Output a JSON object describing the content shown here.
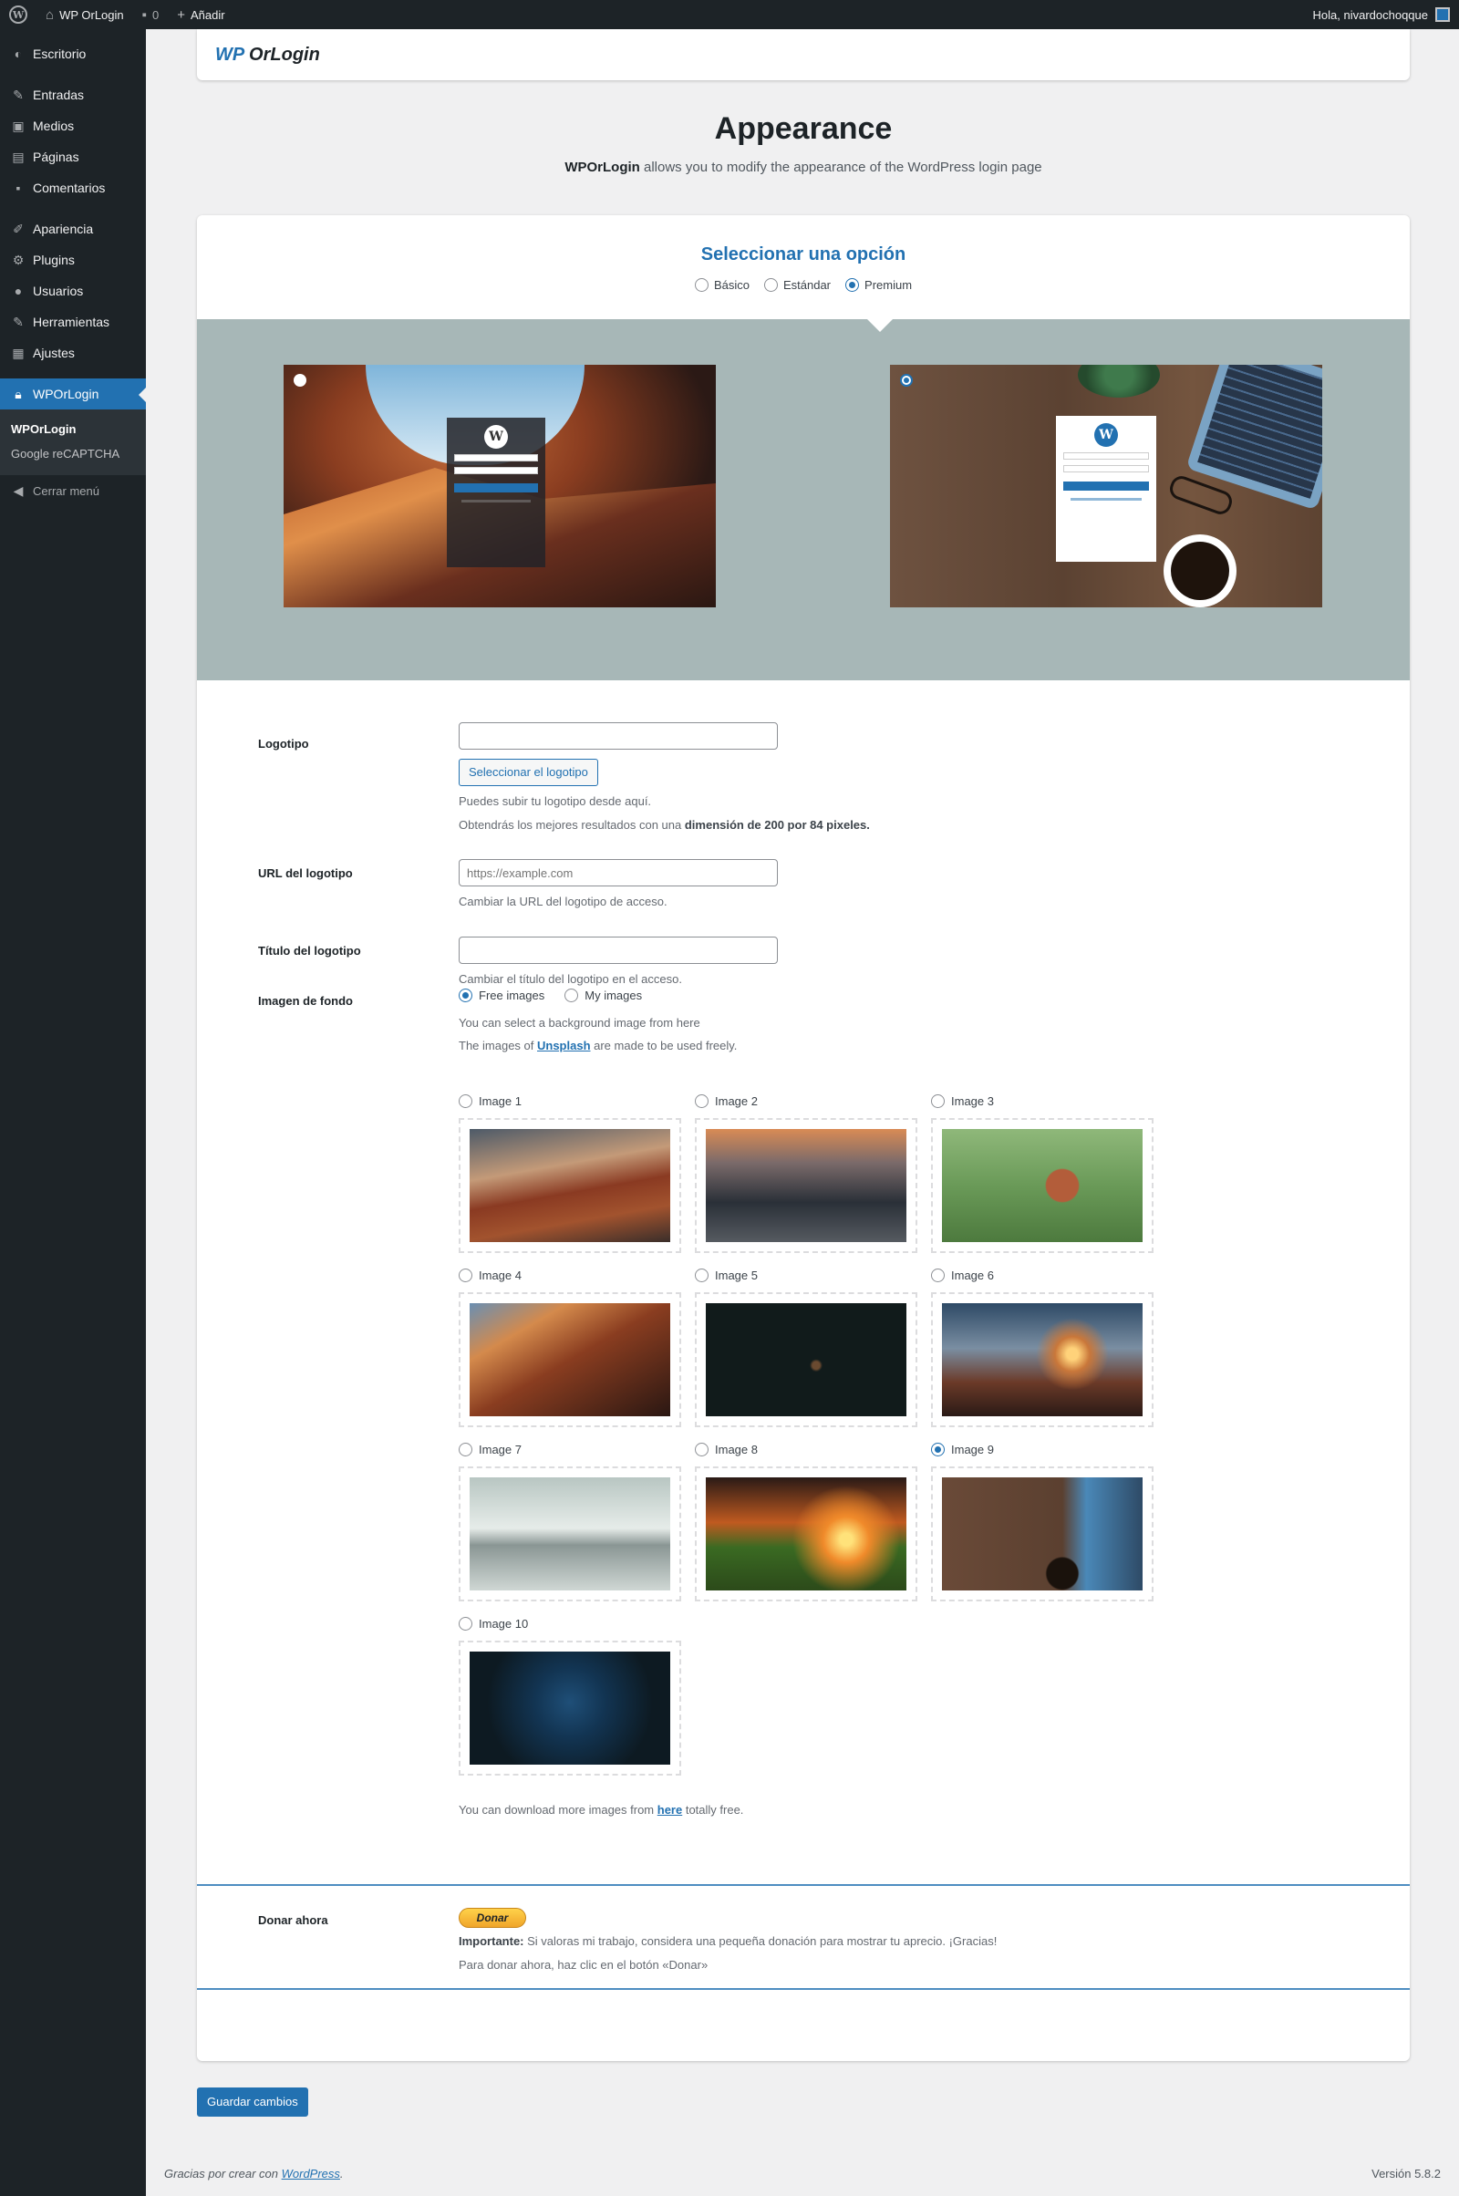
{
  "adminbar": {
    "site_name": "WP OrLogin",
    "comments_count": "0",
    "new_label": "Añadir",
    "greeting": "Hola, nivardochoqque"
  },
  "sidebar": {
    "items": [
      {
        "label": "Escritorio",
        "icon": "dashboard-icon"
      },
      {
        "label": "Entradas",
        "icon": "pin-icon"
      },
      {
        "label": "Medios",
        "icon": "media-icon"
      },
      {
        "label": "Páginas",
        "icon": "page-icon"
      },
      {
        "label": "Comentarios",
        "icon": "comment-icon"
      },
      {
        "label": "Apariencia",
        "icon": "brush-icon"
      },
      {
        "label": "Plugins",
        "icon": "plugin-icon"
      },
      {
        "label": "Usuarios",
        "icon": "user-icon"
      },
      {
        "label": "Herramientas",
        "icon": "wrench-icon"
      },
      {
        "label": "Ajustes",
        "icon": "settings-icon"
      },
      {
        "label": "WPOrLogin",
        "icon": "lock-icon"
      }
    ],
    "submenu": [
      "WPOrLogin",
      "Google reCAPTCHA"
    ],
    "collapse_label": "Cerrar menú"
  },
  "brand": {
    "wp": "WP",
    "name": "OrLogin"
  },
  "header": {
    "title": "Appearance",
    "subtitle_bold": "WPOrLogin",
    "subtitle_rest": " allows you to modify the appearance of the WordPress login page"
  },
  "options": {
    "title": "Seleccionar una opción",
    "radios": [
      "Básico",
      "Estándar",
      "Premium"
    ],
    "selected": "Premium"
  },
  "form": {
    "logo": {
      "label": "Logotipo",
      "button": "Seleccionar el logotipo",
      "desc1": "Puedes subir tu logotipo desde aquí.",
      "desc2_pre": "Obtendrás los mejores resultados con una ",
      "desc2_bold": "dimensión de 200 por 84 pixeles."
    },
    "logo_url": {
      "label": "URL del logotipo",
      "placeholder": "https://example.com",
      "desc": "Cambiar la URL del logotipo de acceso."
    },
    "logo_title": {
      "label": "Título del logotipo",
      "desc": "Cambiar el título del logotipo en el acceso."
    },
    "background": {
      "label": "Imagen de fondo",
      "radios": [
        "Free images",
        "My images"
      ],
      "selected": "Free images",
      "desc1": "You can select a background image from here",
      "desc2_pre": "The images of ",
      "desc2_link": "Unsplash",
      "desc2_post": " are made to be used freely.",
      "images": [
        "Image 1",
        "Image 2",
        "Image 3",
        "Image 4",
        "Image 5",
        "Image 6",
        "Image 7",
        "Image 8",
        "Image 9",
        "Image 10"
      ],
      "selected_image": "Image 9",
      "more_pre": "You can download more images from ",
      "more_link": "here",
      "more_post": " totally free."
    },
    "donate": {
      "label": "Donar ahora",
      "button": "Donar",
      "important_bold": "Importante:",
      "important_rest": " Si valoras mi trabajo, considera una pequeña donación para mostrar tu aprecio. ¡Gracias!",
      "instruction": "Para donar ahora, haz clic en el botón «Donar»"
    }
  },
  "save_button": "Guardar cambios",
  "footer": {
    "thanks_pre": "Gracias por crear con ",
    "thanks_link": "WordPress",
    "thanks_post": ".",
    "version": "Versión 5.8.2"
  },
  "colors": {
    "accent": "#2271b1",
    "sidebar": "#1d2327",
    "preview_band": "#a7b7b7"
  }
}
